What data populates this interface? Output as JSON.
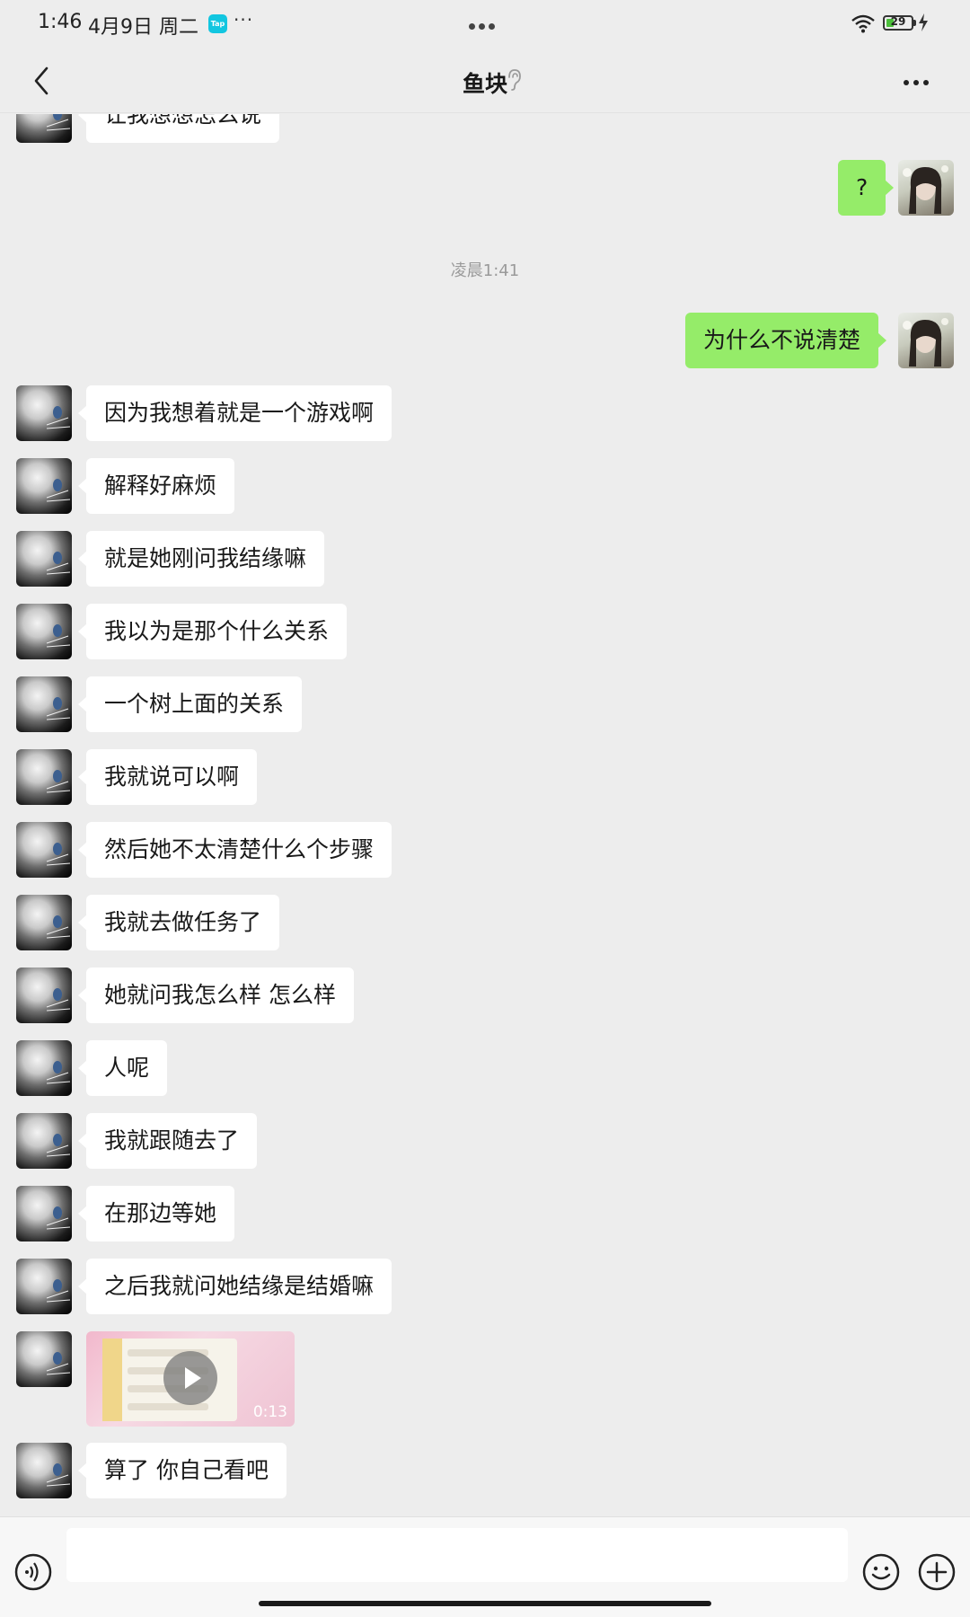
{
  "status_bar": {
    "time": "1:46",
    "date": "4月9日 周二",
    "tap_app_label": "Tap",
    "more": "···",
    "battery_level": "29",
    "battery_fraction": 0.29
  },
  "header": {
    "title": "鱼块"
  },
  "colors": {
    "background": "#ededed",
    "incoming_bubble": "#ffffff",
    "outgoing_bubble": "#95ec69",
    "timestamp_text": "#9a9a9a"
  },
  "messages": [
    {
      "side": "in",
      "text": "让我想想怎么说"
    },
    {
      "side": "out",
      "text": "?"
    },
    {
      "type": "time",
      "text": "凌晨1:41"
    },
    {
      "side": "out",
      "text": "为什么不说清楚"
    },
    {
      "side": "in",
      "text": "因为我想着就是一个游戏啊"
    },
    {
      "side": "in",
      "text": "解释好麻烦"
    },
    {
      "side": "in",
      "text": "就是她刚问我结缘嘛"
    },
    {
      "side": "in",
      "text": "我以为是那个什么关系"
    },
    {
      "side": "in",
      "text": "一个树上面的关系"
    },
    {
      "side": "in",
      "text": "我就说可以啊"
    },
    {
      "side": "in",
      "text": "然后她不太清楚什么个步骤"
    },
    {
      "side": "in",
      "text": "我就去做任务了"
    },
    {
      "side": "in",
      "text": "她就问我怎么样 怎么样"
    },
    {
      "side": "in",
      "text": "人呢"
    },
    {
      "side": "in",
      "text": "我就跟随去了"
    },
    {
      "side": "in",
      "text": "在那边等她"
    },
    {
      "side": "in",
      "text": "之后我就问她结缘是结婚嘛"
    },
    {
      "side": "in",
      "type": "video",
      "duration": "0:13"
    },
    {
      "side": "in",
      "text": "算了 你自己看吧"
    }
  ],
  "input": {
    "value": ""
  }
}
